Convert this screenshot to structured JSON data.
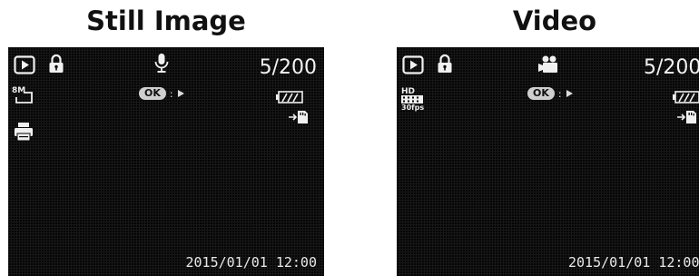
{
  "panels": [
    {
      "heading": "Still Image",
      "counter": "5/200",
      "ok_label": "OK",
      "ok_separator": ":",
      "datetime": "2015/01/01 12:00",
      "resolution_label": "8M",
      "mode_icon": "microphone-icon"
    },
    {
      "heading": "Video",
      "counter": "5/200",
      "ok_label": "OK",
      "ok_separator": ":",
      "datetime": "2015/01/01 12:00",
      "resolution_label": "HD",
      "fps_label": "30fps",
      "mode_icon": "movie-camera-icon"
    }
  ],
  "colors": {
    "screen_background": "#050505",
    "overlay_text": "#f2f2f2",
    "ok_badge": "#cfcfcf"
  }
}
